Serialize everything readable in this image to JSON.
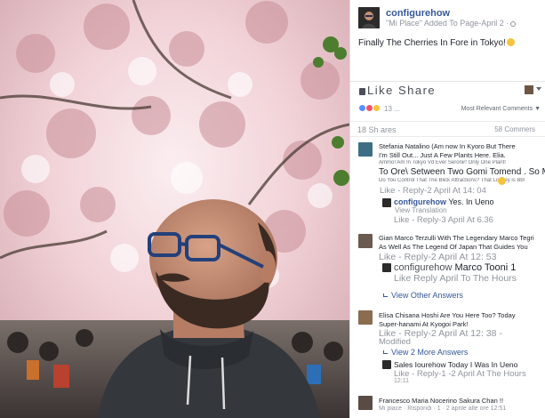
{
  "post": {
    "author": "configurehow",
    "subline": "\"Mi Place\" Added To Page-April 2 ·",
    "text": "Finally The Cherries In Fore in Tokyo!"
  },
  "actions": {
    "like_share": "Like Share"
  },
  "reactions": {
    "count": "13 ...",
    "sort": "Most Relevant Comments ▼"
  },
  "stats": {
    "shares": "18 Sh ares",
    "comments": "58 Commers"
  },
  "comments": [
    {
      "lines": [
        "Stefania Natalino (Am now In Kyoro But There",
        "I'm Still Out... Just A Few Plants Here. Elia.",
        "Ammo! Am In Tokyo Vd Ever Seronir! Only One Plant!"
      ],
      "big": [
        "To Ore\\ Setween Two Gomi Tomend . So Me",
        "Do You Control That The Blick Attractions? That Lookey is Bb!"
      ],
      "meta": "Like - Reply-2 April At 14: 04"
    },
    {
      "name": "configurehow",
      "text": "Yes. In Ueno",
      "translation": "View Translation",
      "meta": "Like - Reply-3 April At 6.36"
    },
    {
      "lines": [
        "Gian Marco Terzulli With The Legendary Marco Tegri",
        "As Well As The Legend Of Japan That Guides You"
      ],
      "meta": "Like - Reply-2 April At 12: 53"
    },
    {
      "name": "configurehow",
      "text": "Marco Tooni 1",
      "meta": "Like Reply April To The Hours",
      "link": "View Other Answers"
    },
    {
      "lines": [
        "Elisa Chisana Hoshi Are You Here Too? Today",
        "Super-hanami At Kyogoi Park!"
      ],
      "meta": "Like - Reply-2 April At 12: 38 -",
      "meta2": "Modified",
      "link": "View 2 More Answers"
    },
    {
      "text": "Sales Iourehow Today I Was In Ueno",
      "meta": "Like - Reply-1 -2 April At The Hours",
      "meta2": "12:11"
    },
    {
      "lines": [
        "Francesco Maria Nocerino Sakura Chan !!",
        "Mi piace · Rispondi · 1 · 2 aprile alle ore 12:51"
      ]
    }
  ]
}
